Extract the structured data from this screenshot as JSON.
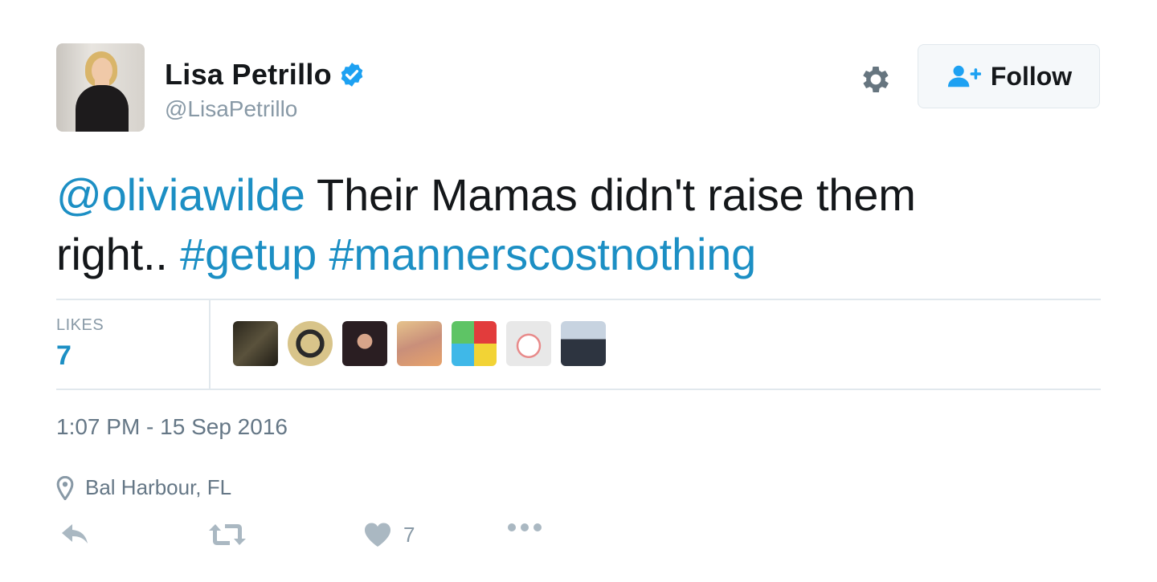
{
  "author": {
    "display_name": "Lisa Petrillo",
    "handle": "@LisaPetrillo",
    "verified": true
  },
  "header": {
    "follow_label": "Follow",
    "settings_icon": "gear-icon"
  },
  "tweet": {
    "mention": "@oliviawilde",
    "text_line1": " Their Mamas didn't raise them",
    "text_line2": "right.. ",
    "hashtag1": "#getup",
    "hashtag2": "#mannerscostnothing"
  },
  "stats": {
    "likes_label": "LIKES",
    "likes_count": "7"
  },
  "meta": {
    "timestamp": "1:07 PM - 15 Sep 2016",
    "location": "Bal Harbour, FL"
  },
  "actions": {
    "like_count": "7"
  },
  "colors": {
    "link": "#1c8fc4",
    "muted": "#8899a6",
    "border": "#e1e8ed",
    "verified": "#1da1f2"
  }
}
